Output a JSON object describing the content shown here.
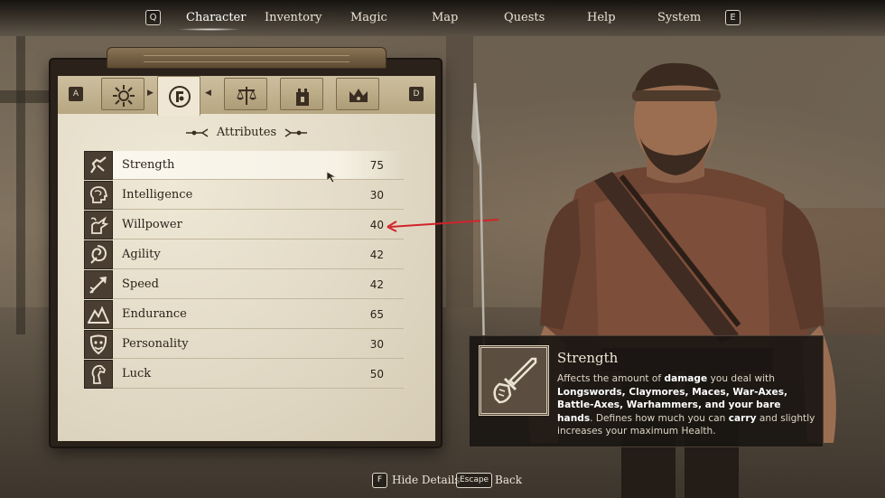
{
  "nav": {
    "left_key": "Q",
    "right_key": "E",
    "items": [
      "Character",
      "Inventory",
      "Magic",
      "Map",
      "Quests",
      "Help",
      "System"
    ],
    "active": "Character"
  },
  "panel": {
    "tab_left_key": "A",
    "tab_right_key": "D",
    "tabs": [
      {
        "icon": "sun-sigil-icon"
      },
      {
        "icon": "character-crest-icon",
        "active": true
      },
      {
        "icon": "scales-icon"
      },
      {
        "icon": "tower-icon"
      },
      {
        "icon": "crown-icon"
      }
    ],
    "section_title": "Attributes"
  },
  "attributes": [
    {
      "label": "Strength",
      "value": "75",
      "icon": "strength-arm-icon",
      "selected": true
    },
    {
      "label": "Intelligence",
      "value": "30",
      "icon": "brain-head-icon"
    },
    {
      "label": "Willpower",
      "value": "40",
      "icon": "willpower-hand-icon"
    },
    {
      "label": "Agility",
      "value": "42",
      "icon": "agility-swirl-icon"
    },
    {
      "label": "Speed",
      "value": "42",
      "icon": "speed-arrow-icon"
    },
    {
      "label": "Endurance",
      "value": "65",
      "icon": "endurance-mountain-icon"
    },
    {
      "label": "Personality",
      "value": "30",
      "icon": "personality-mask-icon"
    },
    {
      "label": "Luck",
      "value": "50",
      "icon": "luck-horse-icon"
    }
  ],
  "detail": {
    "title": "Strength",
    "icon": "strength-sword-fist-icon",
    "description_parts": [
      {
        "text": "Affects the amount of ",
        "bold": false
      },
      {
        "text": "damage",
        "bold": true
      },
      {
        "text": " you deal with ",
        "bold": false
      },
      {
        "text": "Longswords, Claymores, Maces, War-Axes, Battle-Axes, Warhammers, and your bare hands",
        "bold": true
      },
      {
        "text": ". Defines how much you can ",
        "bold": false
      },
      {
        "text": "carry",
        "bold": true
      },
      {
        "text": " and slightly increases your maximum Health.",
        "bold": false
      }
    ]
  },
  "bottom": {
    "hide_key": "F",
    "hide_label": "Hide Details",
    "back_key": "Escape",
    "back_label": "Back"
  },
  "colors": {
    "parchment": "#e8e0cc",
    "annotation_arrow": "#d2232a",
    "detail_bg": "#1a1612"
  }
}
